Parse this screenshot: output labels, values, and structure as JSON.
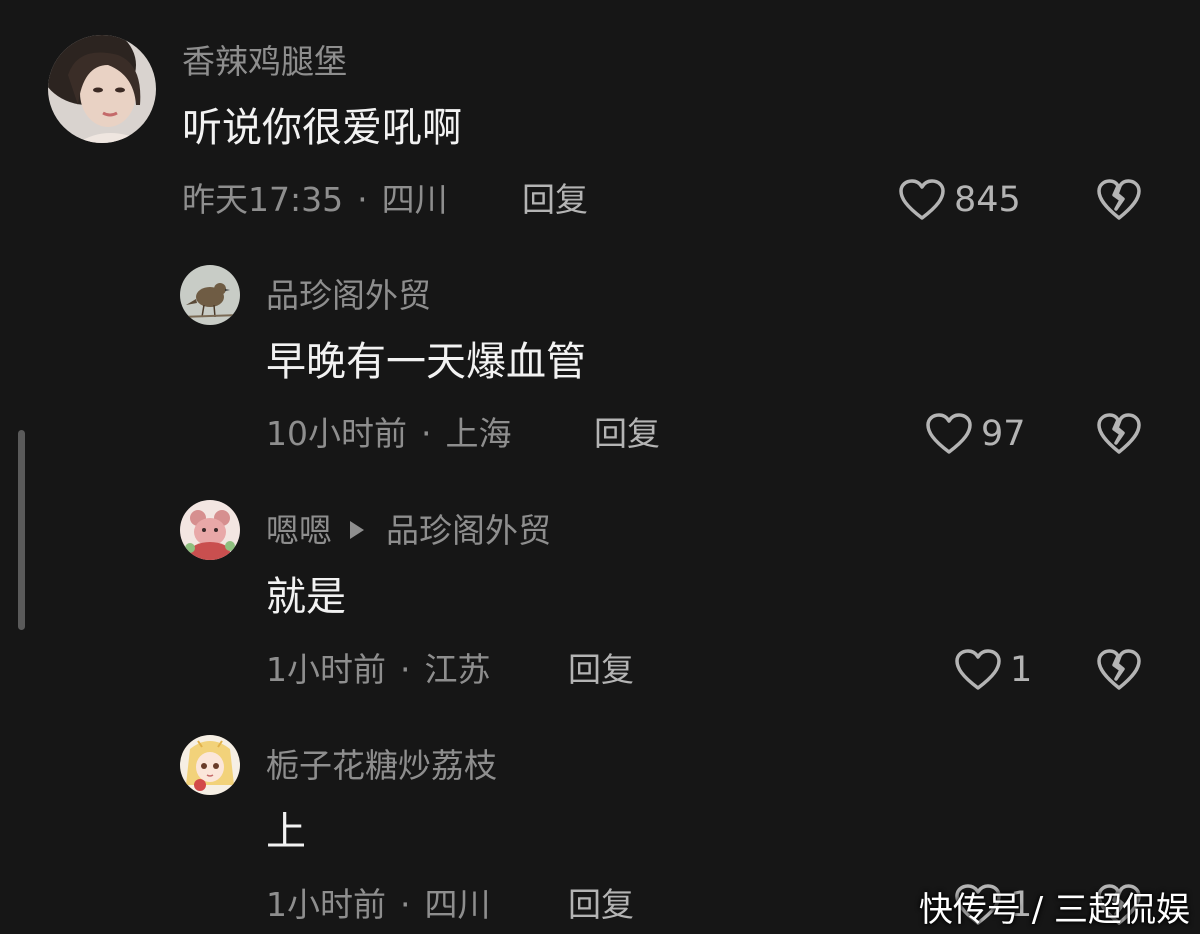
{
  "comments": [
    {
      "username": "香辣鸡腿堡",
      "text": "听说你很爱吼啊",
      "time": "昨天17:35",
      "location": "四川",
      "reply_label": "回复",
      "likes": "845"
    },
    {
      "username": "品珍阁外贸",
      "text": "早晚有一天爆血管",
      "time": "10小时前",
      "location": "上海",
      "reply_label": "回复",
      "likes": "97"
    },
    {
      "username": "嗯嗯",
      "reply_to": "品珍阁外贸",
      "text": "就是",
      "time": "1小时前",
      "location": "江苏",
      "reply_label": "回复",
      "likes": "1"
    },
    {
      "username": "栀子花糖炒荔枝",
      "text": "上",
      "time": "1小时前",
      "location": "四川",
      "reply_label": "回复",
      "likes": "1"
    }
  ],
  "separator": "·",
  "watermark": "快传号 / 三超侃娱",
  "icons": {
    "like": "heart-outline-icon",
    "dislike": "broken-heart-icon"
  },
  "colors": {
    "background": "#161616",
    "secondary_text": "#8e8e8e",
    "primary_text": "#f2f2f2"
  }
}
